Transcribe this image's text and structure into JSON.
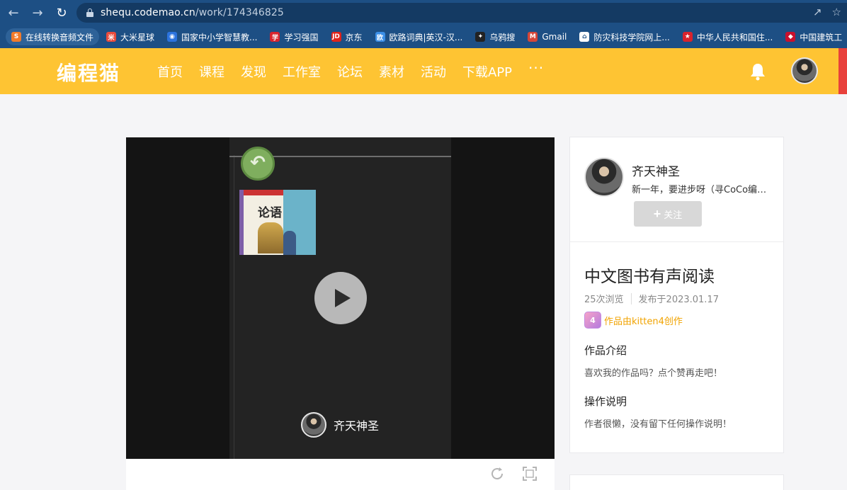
{
  "browser": {
    "url_domain": "shequ.codemao.cn",
    "url_path": "/work/174346825",
    "bookmarks": [
      {
        "label": "在线转换音频文件",
        "color": "#f27b2a",
        "glyph": "S"
      },
      {
        "label": "大米星球",
        "color": "#e94b3c",
        "glyph": "米"
      },
      {
        "label": "国家中小学智慧教...",
        "color": "#2b73de",
        "glyph": "◉"
      },
      {
        "label": "学习强国",
        "color": "#d9232d",
        "glyph": "学"
      },
      {
        "label": "京东",
        "color": "#e2231a",
        "glyph": "JD"
      },
      {
        "label": "欧路词典|英汉-汉...",
        "color": "#3a8ee6",
        "glyph": "欧"
      },
      {
        "label": "乌鸦搜",
        "color": "#222222",
        "glyph": "✦"
      },
      {
        "label": "Gmail",
        "color": "#d44638",
        "glyph": "M"
      },
      {
        "label": "防灾科技学院网上...",
        "color": "#ffffff",
        "glyph": "⌂"
      },
      {
        "label": "中华人民共和国住...",
        "color": "#d9232d",
        "glyph": "★"
      },
      {
        "label": "中国建筑工",
        "color": "#c8102e",
        "glyph": "◆"
      }
    ]
  },
  "header": {
    "logo": "编程猫",
    "nav": [
      "首页",
      "课程",
      "发现",
      "工作室",
      "论坛",
      "素材",
      "活动",
      "下载APP"
    ],
    "more": "···",
    "accent": "#fec433"
  },
  "player": {
    "book_title": "论语",
    "author_name": "齐天神圣"
  },
  "sidebar": {
    "author_name": "齐天神圣",
    "author_signature": "新一年，要进步呀（寻CoCo编辑器好友）",
    "follow_label": "关注",
    "work_title": "中文图书有声阅读",
    "views": "25次浏览",
    "published": "发布于2023.01.17",
    "creator_label": "作品由kitten4创作",
    "intro_heading": "作品介绍",
    "intro_text": "喜欢我的作品吗？点个赞再走吧！",
    "instructions_heading": "操作说明",
    "instructions_text": "作者很懒，没有留下任何操作说明！"
  }
}
